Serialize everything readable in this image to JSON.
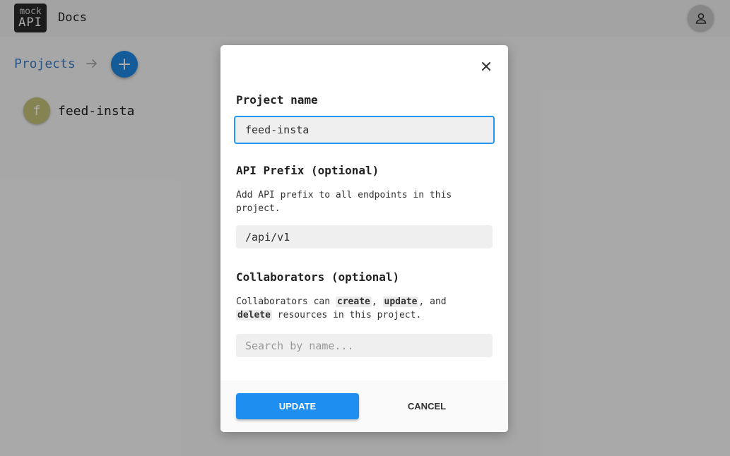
{
  "header": {
    "logo_top": "mock",
    "logo_bottom": "API",
    "docs_link": "Docs"
  },
  "breadcrumb": {
    "projects": "Projects"
  },
  "projects": [
    {
      "initial": "f",
      "name": "feed-insta"
    }
  ],
  "modal": {
    "project_name_label": "Project name",
    "project_name_value": "feed-insta",
    "api_prefix_label": "API Prefix (optional)",
    "api_prefix_desc": "Add API prefix to all endpoints in this project.",
    "api_prefix_value": "/api/v1",
    "collaborators_label": "Collaborators (optional)",
    "collab_desc": {
      "prefix": "Collaborators can ",
      "create": "create",
      "sep1": ", ",
      "update": "update",
      "sep2": ", and ",
      "delete": "delete",
      "suffix": " resources in this project."
    },
    "search_placeholder": "Search by name...",
    "update_button": "UPDATE",
    "cancel_button": "CANCEL"
  },
  "colors": {
    "accent": "#1e88e5",
    "link": "#3f7fc9",
    "project_avatar": "#c8c47c"
  },
  "icons": {
    "avatar": "user-icon",
    "breadcrumb_separator": "arrow-right-icon",
    "add": "plus-icon",
    "close": "close-icon"
  }
}
